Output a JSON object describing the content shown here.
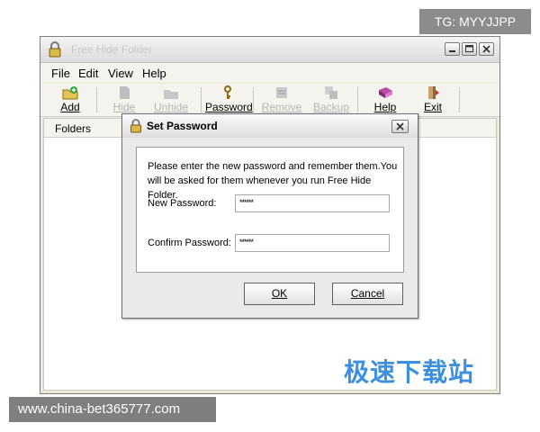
{
  "window": {
    "title": "Free Hide Folder",
    "icon": "lock-icon"
  },
  "menu": [
    "File",
    "Edit",
    "View",
    "Help"
  ],
  "toolbar": [
    {
      "label": "Add",
      "icon": "add-folder-icon",
      "enabled": true
    },
    {
      "label": "Hide",
      "icon": "hide-icon",
      "enabled": false
    },
    {
      "label": "Unhide",
      "icon": "unhide-icon",
      "enabled": false
    },
    {
      "label": "Password",
      "icon": "key-icon",
      "enabled": true
    },
    {
      "label": "Remove",
      "icon": "remove-icon",
      "enabled": false
    },
    {
      "label": "Backup",
      "icon": "backup-icon",
      "enabled": false
    },
    {
      "label": "Help",
      "icon": "help-book-icon",
      "enabled": true
    },
    {
      "label": "Exit",
      "icon": "exit-icon",
      "enabled": true
    }
  ],
  "list": {
    "column_header": "Folders"
  },
  "dialog": {
    "title": "Set Password",
    "message": "Please enter the new password and remember them.You will be asked for them whenever you run Free Hide Folder.",
    "new_password_label": "New Password:",
    "new_password_value": "******",
    "confirm_password_label": "Confirm Password:",
    "confirm_password_value": "******",
    "ok_label": "OK",
    "cancel_label": "Cancel"
  },
  "overlays": {
    "tg_text": "TG: MYYJJPP",
    "watermark": "极速下载站",
    "site_text": "www.china-bet365777.com"
  },
  "colors": {
    "watermark": "#3d8fe0",
    "overlay_bg": "#8c8c8c"
  }
}
